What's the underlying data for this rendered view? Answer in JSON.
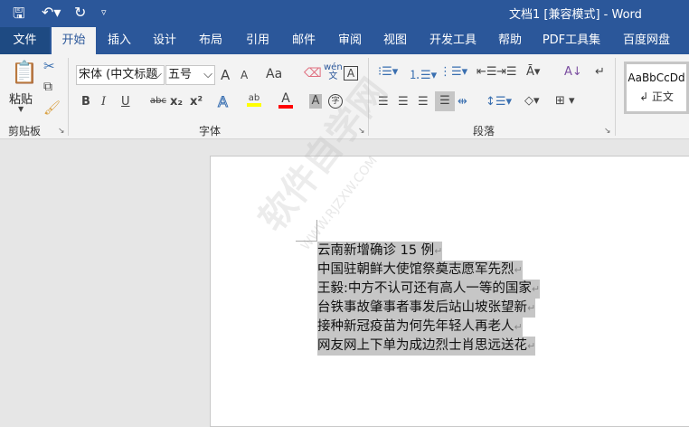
{
  "window": {
    "title": "文档1 [兼容模式]  -  Word"
  },
  "tabs": [
    "文件",
    "开始",
    "插入",
    "设计",
    "布局",
    "引用",
    "邮件",
    "审阅",
    "视图",
    "开发工具",
    "帮助",
    "PDF工具集",
    "百度网盘"
  ],
  "clipboard": {
    "paste": "粘贴",
    "label": "剪贴板"
  },
  "font": {
    "name": "宋体 (中文标题",
    "size": "五号",
    "label": "字体",
    "grow": "A",
    "shrink": "A",
    "case": "Aa",
    "phonetic": "wén",
    "bold": "B",
    "italic": "I",
    "underline": "U",
    "strike": "abc",
    "sub": "x₂",
    "sup": "x²",
    "effects": "A",
    "highlight": "ab",
    "color": "A",
    "shading": "A",
    "enclose": "字",
    "border": "A"
  },
  "paragraph": {
    "label": "段落"
  },
  "styles": {
    "preview": "AaBbCcDd",
    "name": "↲ 正文"
  },
  "colors": {
    "accent": "#2b579a",
    "highlight": "#ffff00",
    "font_color": "#ff0000"
  },
  "watermark": {
    "text": "软件自学网",
    "url": "WWW.RJZXW.COM"
  },
  "document": {
    "lines": [
      "云南新增确诊 15 例",
      "中国驻朝鲜大使馆祭奠志愿军先烈",
      "王毅:中方不认可还有高人一等的国家",
      "台铁事故肇事者事发后站山坡张望新",
      "接种新冠疫苗为何先年轻人再老人",
      "网友网上下单为成边烈士肖思远送花"
    ]
  }
}
